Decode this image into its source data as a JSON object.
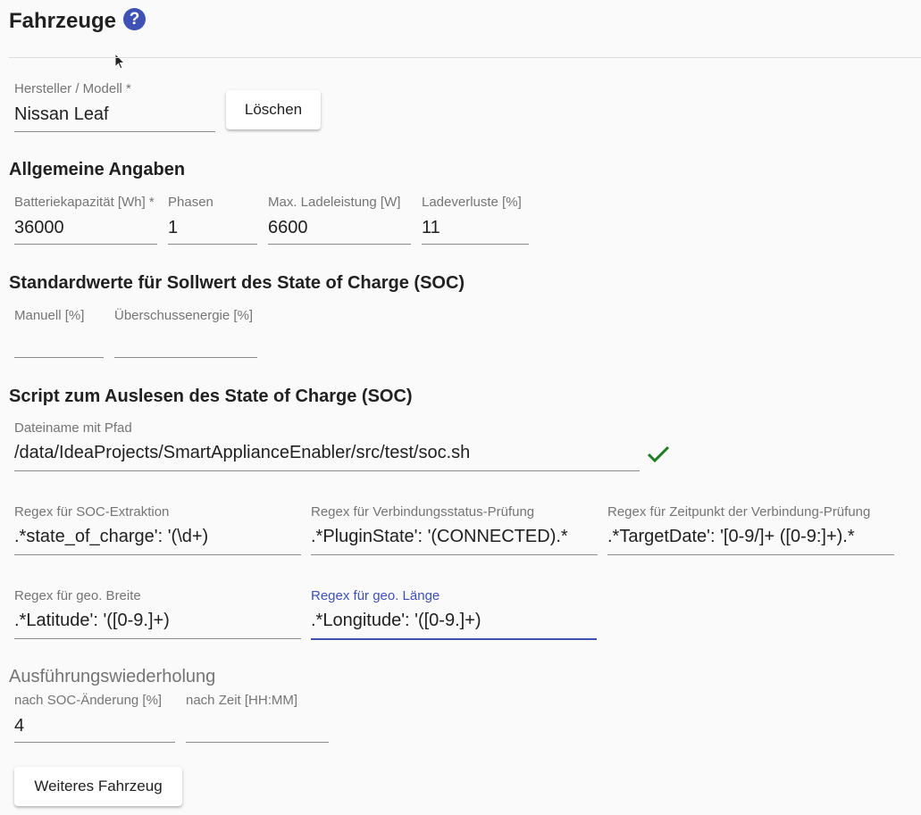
{
  "page": {
    "title": "Fahrzeuge",
    "help_glyph": "?"
  },
  "colors": {
    "accent": "#3f51b5",
    "success": "#1e7d22"
  },
  "icons": {
    "help": "help-circle-icon",
    "valid": "check-icon",
    "cursor": "mouse-pointer-icon"
  },
  "vehicle": {
    "model_label": "Hersteller / Modell *",
    "model_value": "Nissan Leaf",
    "delete_button": "Löschen"
  },
  "general": {
    "heading": "Allgemeine Angaben",
    "battery_label": "Batteriekapazität [Wh] *",
    "battery_value": "36000",
    "phases_label": "Phasen",
    "phases_value": "1",
    "max_power_label": "Max. Ladeleistung [W]",
    "max_power_value": "6600",
    "loss_label": "Ladeverluste [%]",
    "loss_value": "11"
  },
  "soc_defaults": {
    "heading": "Standardwerte für Sollwert des State of Charge (SOC)",
    "manual_label": "Manuell [%]",
    "manual_value": "",
    "surplus_label": "Überschussenergie [%]",
    "surplus_value": ""
  },
  "soc_script": {
    "heading": "Script zum Auslesen des State of Charge (SOC)",
    "file_label": "Dateiname mit Pfad",
    "file_value": "/data/IdeaProjects/SmartApplianceEnabler/src/test/soc.sh",
    "regex_soc_label": "Regex für SOC-Extraktion",
    "regex_soc_value": ".*state_of_charge': '(\\d+)",
    "regex_conn_label": "Regex für Verbindungsstatus-Prüfung",
    "regex_conn_value": ".*PluginState': '(CONNECTED).*",
    "regex_time_label": "Regex für Zeitpunkt der Verbindung-Prüfung",
    "regex_time_value": ".*TargetDate': '[0-9/]+ ([0-9:]+).*",
    "regex_lat_label": "Regex für geo. Breite",
    "regex_lat_value": ".*Latitude': '([0-9.]+)",
    "regex_lon_label": "Regex für geo. Länge",
    "regex_lon_value": ".*Longitude': '([0-9.]+)"
  },
  "repeat": {
    "heading": "Ausführungswiederholung",
    "soc_change_label": "nach SOC-Änderung [%]",
    "soc_change_value": "4",
    "time_label": "nach Zeit [HH:MM]",
    "time_value": ""
  },
  "add_vehicle_button": "Weiteres Fahrzeug"
}
